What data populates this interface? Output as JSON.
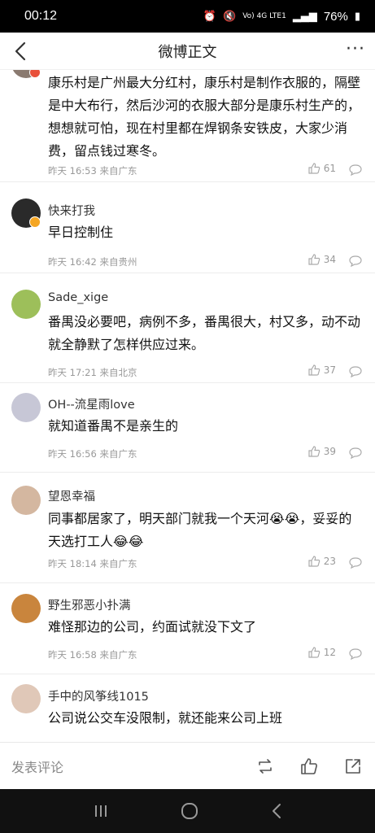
{
  "status_bar": {
    "time": "00:12",
    "network": "Vo) 4G LTE1",
    "battery": "76%"
  },
  "nav": {
    "title": "微博正文",
    "more": "···"
  },
  "comments": [
    {
      "text": "康乐村是广州最大分红村，康乐村是制作衣服的，隔壁是中大布行，然后沙河的衣服大部分是康乐村生产的，想想就可怕，现在村里都在焊钢条安铁皮，大家少消费，留点钱过寒冬。",
      "meta": "昨天 16:53 来自广东",
      "likes": "61",
      "avatar_color": "#8a7a70"
    },
    {
      "user": "快来打我",
      "text": "早日控制住",
      "meta": "昨天 16:42 来自贵州",
      "likes": "34",
      "avatar_color": "#2a2a2a"
    },
    {
      "user": "Sade_xige",
      "text": "番禺没必要吧，病例不多，番禺很大，村又多，动不动就全静默了怎样供应过来。",
      "meta": "昨天 17:21 来自北京",
      "likes": "37",
      "avatar_color": "#9dbf5a"
    },
    {
      "user": "OH--流星雨love",
      "text": "就知道番禺不是亲生的",
      "meta": "昨天 16:56 来自广东",
      "likes": "39",
      "avatar_color": "#c7c7d6"
    },
    {
      "user": "望恩幸福",
      "text": "同事都居家了，明天部门就我一个天河😭😭，妥妥的天选打工人😂😂",
      "meta": "昨天 18:14 来自广东",
      "likes": "23",
      "avatar_color": "#d4b7a0"
    },
    {
      "user": "野生邪恶小扑满",
      "text": "难怪那边的公司，约面试就没下文了",
      "meta": "昨天 16:58 来自广东",
      "likes": "12",
      "avatar_color": "#c9853d"
    },
    {
      "user": "手中的风筝线1015",
      "text": "公司说公交车没限制，就还能来公司上班",
      "avatar_color": "#e0c8b8"
    }
  ],
  "bottom_bar": {
    "placeholder": "发表评论"
  }
}
